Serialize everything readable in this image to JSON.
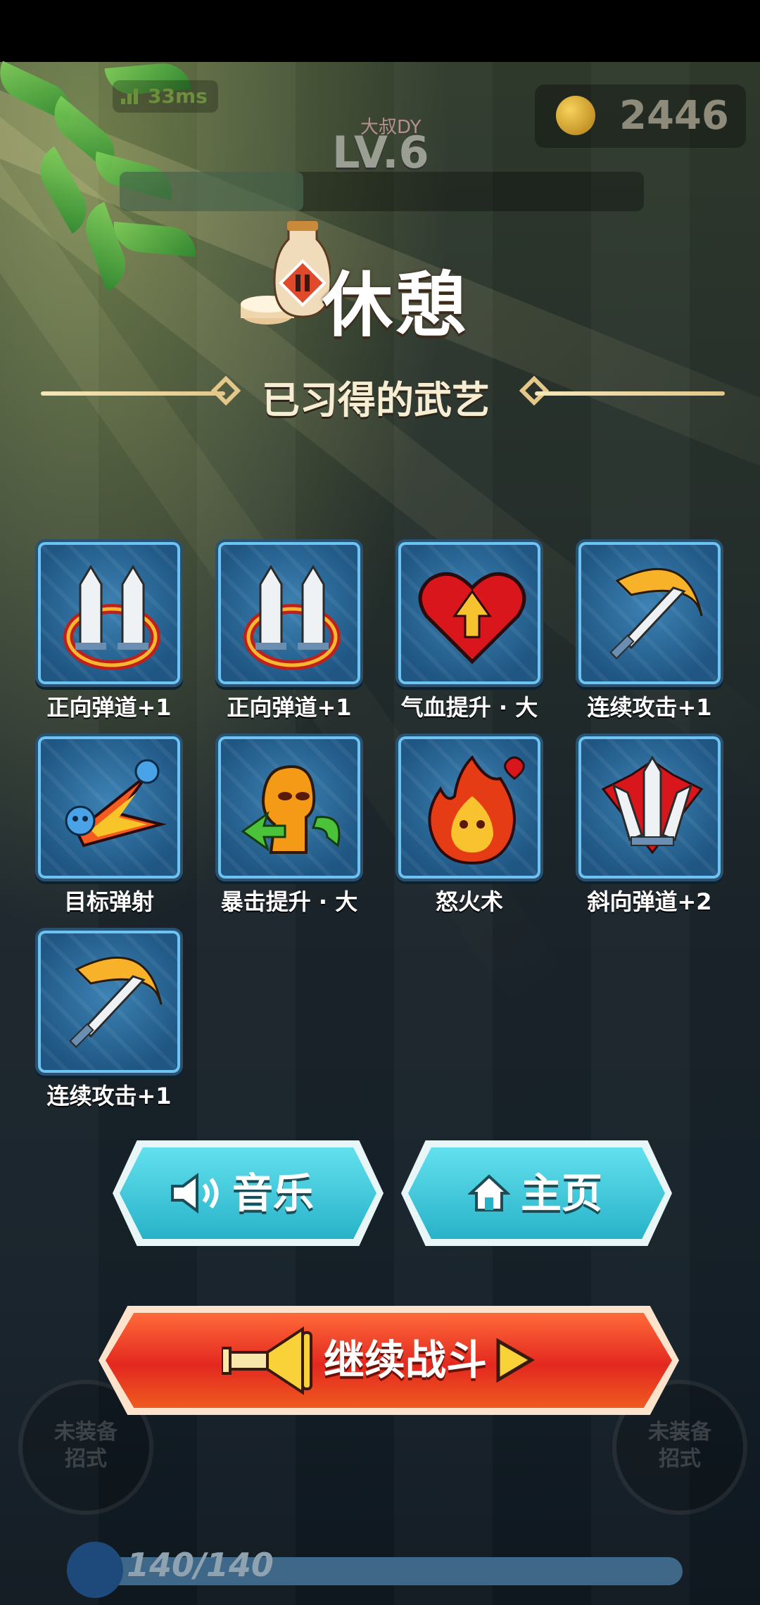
{
  "hud": {
    "ping": "33ms",
    "coins": "2446",
    "level": "LV.6",
    "player_name": "大叔DY"
  },
  "pause": {
    "title": "休憩",
    "subtitle": "已习得的武艺"
  },
  "skills": [
    {
      "label": "正向弹道+1",
      "icon": "twin-swords-icon"
    },
    {
      "label": "正向弹道+1",
      "icon": "twin-swords-icon"
    },
    {
      "label": "气血提升 · 大",
      "icon": "heart-up-icon"
    },
    {
      "label": "连续攻击+1",
      "icon": "sword-slash-icon"
    },
    {
      "label": "目标弹射",
      "icon": "skull-bounce-icon"
    },
    {
      "label": "暴击提升 · 大",
      "icon": "crit-head-icon"
    },
    {
      "label": "怒火术",
      "icon": "rage-fire-icon"
    },
    {
      "label": "斜向弹道+2",
      "icon": "spread-swords-icon"
    },
    {
      "label": "连续攻击+1",
      "icon": "sword-slash-icon"
    }
  ],
  "buttons": {
    "music": "音乐",
    "home": "主页",
    "continue": "继续战斗"
  },
  "background": {
    "slot_left": "未装备\n招式",
    "slot_right": "未装备\n招式",
    "hp": "140/140",
    "hp_fraction": 1.0
  },
  "colors": {
    "teal_button": "#3cc6d8",
    "red_button": "#e8402f",
    "gold_line": "#e4c789",
    "card_blue": "#2b6b9e"
  }
}
